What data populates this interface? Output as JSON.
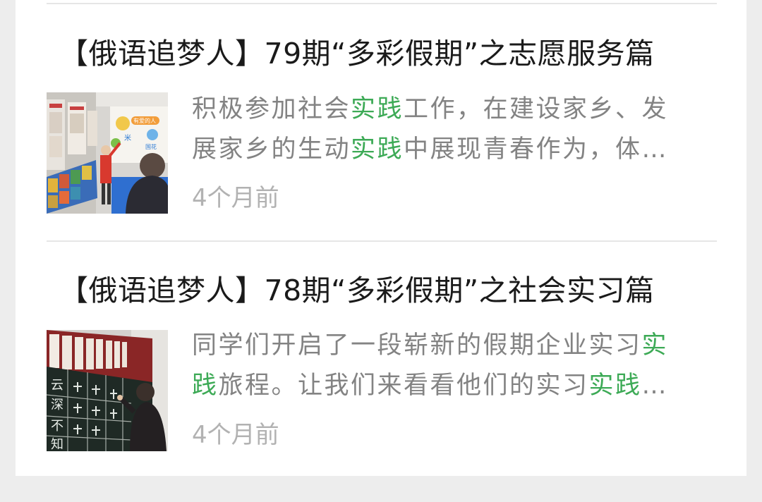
{
  "articles": [
    {
      "title": "【俄语追梦人】79期“多彩假期”之志愿服务篇",
      "summary_line1": [
        "积极参加社会",
        "实践",
        "工作，在建设家乡、发"
      ],
      "summary_line2": [
        "展家乡的生动",
        "实践",
        "中展现青春作为，体…"
      ],
      "time": "4个月前",
      "thumbnail_icon": "volunteer-exhibition-photo",
      "thumbnail_poster_text": [
        "有爱的人",
        "米",
        "国花"
      ]
    },
    {
      "title": "【俄语追梦人】78期“多彩假期”之社会实习篇",
      "summary_line1": [
        "同学们开启了一段崭新的假期企业实习",
        "实"
      ],
      "summary_line2": [
        "践",
        "旅程。让我们来看看他们的实习",
        "实践",
        "…"
      ],
      "time": "4个月前",
      "thumbnail_icon": "calligraphy-blackboard-photo",
      "thumbnail_board_text": [
        "云",
        "深",
        "不",
        "知"
      ]
    }
  ],
  "colors": {
    "background": "#ededed",
    "card": "#ffffff",
    "title": "#1a1a1a",
    "summary": "#838383",
    "highlight": "#3daa56",
    "time": "#b2b2b2",
    "divider": "#e6e6e6"
  }
}
